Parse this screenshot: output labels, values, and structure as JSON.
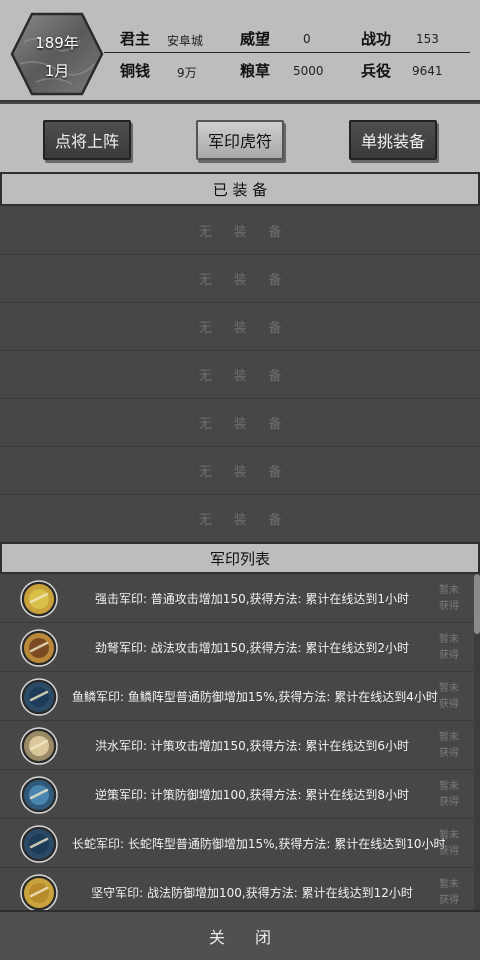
{
  "header": {
    "year": "189年",
    "month": "1月",
    "stats": [
      {
        "label": "君主",
        "value": "安阜城"
      },
      {
        "label": "威望",
        "value": "0"
      },
      {
        "label": "战功",
        "value": "153"
      },
      {
        "label": "铜钱",
        "value": "9万"
      },
      {
        "label": "粮草",
        "value": "5000"
      },
      {
        "label": "兵役",
        "value": "9641"
      }
    ]
  },
  "tabs": [
    {
      "label": "点将上阵",
      "active": false
    },
    {
      "label": "军印虎符",
      "active": true
    },
    {
      "label": "单挑装备",
      "active": false
    }
  ],
  "equipped": {
    "title": "已 装 备",
    "empty_label": "无装备",
    "slot_count": 7
  },
  "seal_list": {
    "title": "军印列表",
    "items": [
      {
        "icon": "sword-seal-icon",
        "desc": "强击军印: 普通攻击增加150,获得方法: 累计在线达到1小时",
        "status": "暂未获得",
        "ring": "#c9a23c",
        "core": "#d8c04a"
      },
      {
        "icon": "crossbow-seal-icon",
        "desc": "劲弩军印: 战法攻击增加150,获得方法: 累计在线达到2小时",
        "status": "暂未获得",
        "ring": "#b8893a",
        "core": "#7a4a22"
      },
      {
        "icon": "fish-scale-formation-icon",
        "desc": "鱼鳞军印: 鱼鳞阵型普通防御增加15%,获得方法: 累计在线达到4小时",
        "status": "暂未获得",
        "ring": "#2b4a66",
        "core": "#1d3c5a"
      },
      {
        "icon": "flood-seal-icon",
        "desc": "洪水军印: 计策攻击增加150,获得方法: 累计在线达到6小时",
        "status": "暂未获得",
        "ring": "#9a8a66",
        "core": "#d9c79a"
      },
      {
        "icon": "counter-strategy-seal-icon",
        "desc": "逆策军印: 计策防御增加100,获得方法: 累计在线达到8小时",
        "status": "暂未获得",
        "ring": "#2f5a7a",
        "core": "#4a86b0"
      },
      {
        "icon": "snake-formation-icon",
        "desc": "长蛇军印: 长蛇阵型普通防御增加15%,获得方法: 累计在线达到10小时",
        "status": "暂未获得",
        "ring": "#2b4a66",
        "core": "#1d3c5a"
      },
      {
        "icon": "shield-seal-icon",
        "desc": "坚守军印: 战法防御增加100,获得方法: 累计在线达到12小时",
        "status": "暂未获得",
        "ring": "#c9a23c",
        "core": "#b88a2a"
      }
    ]
  },
  "close_label": "关闭"
}
